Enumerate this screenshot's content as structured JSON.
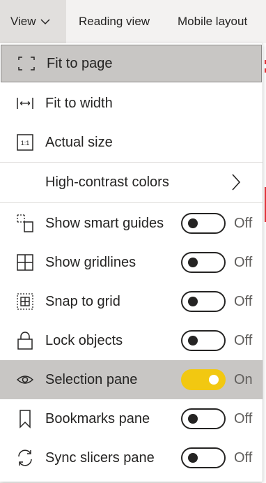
{
  "toolbar": {
    "view_label": "View",
    "reading_view_label": "Reading view",
    "mobile_layout_label": "Mobile layout"
  },
  "menu": {
    "fit_to_page": "Fit to page",
    "fit_to_width": "Fit to width",
    "actual_size": "Actual size",
    "actual_size_icon_text": "1:1",
    "high_contrast": "High-contrast colors",
    "toggles": [
      {
        "label": "Show smart guides",
        "state": "Off",
        "on": false
      },
      {
        "label": "Show gridlines",
        "state": "Off",
        "on": false
      },
      {
        "label": "Snap to grid",
        "state": "Off",
        "on": false
      },
      {
        "label": "Lock objects",
        "state": "Off",
        "on": false
      },
      {
        "label": "Selection pane",
        "state": "On",
        "on": true
      },
      {
        "label": "Bookmarks pane",
        "state": "Off",
        "on": false
      },
      {
        "label": "Sync slicers pane",
        "state": "Off",
        "on": false
      }
    ]
  },
  "colors": {
    "toggle_on": "#f2c811",
    "selected_row": "#c8c6c4",
    "accent_red": "#e8333a"
  }
}
